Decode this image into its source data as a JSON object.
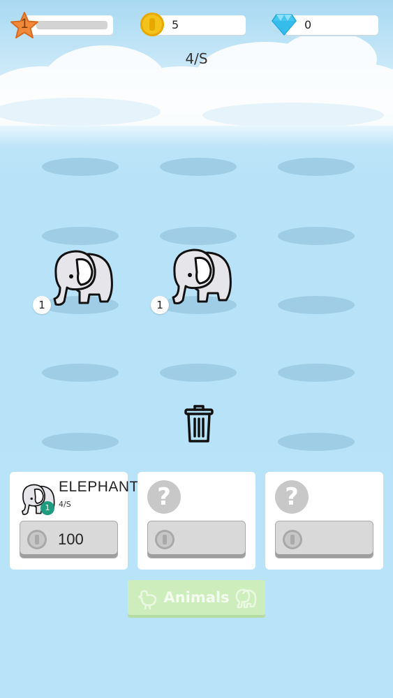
{
  "hud": {
    "level": "1",
    "level_progress": 0.0,
    "coins": "5",
    "gems": "0",
    "income_rate": "4/S"
  },
  "field": {
    "animals": [
      {
        "name": "elephant",
        "level": "1"
      },
      {
        "name": "elephant",
        "level": "1"
      }
    ]
  },
  "shop": {
    "cards": [
      {
        "name": "ELEPHANT",
        "rate": "4/S",
        "badge": "1",
        "price": "100",
        "locked": false
      },
      {
        "name": "",
        "rate": "",
        "badge": "",
        "price": "",
        "locked": true
      },
      {
        "name": "",
        "rate": "",
        "badge": "",
        "price": "",
        "locked": true
      }
    ],
    "mystery_glyph": "?"
  },
  "animals_button": {
    "label": "Animals"
  },
  "colors": {
    "sky": "#b9e3f8",
    "level_star": "#f08a3a",
    "coin": "#f4c21a",
    "gem": "#43c6f0",
    "badge_green": "#1f9c7f",
    "animals_button": "#cdeebc"
  },
  "icons": [
    "star-icon",
    "coin-icon",
    "diamond-icon",
    "trash-icon",
    "elephant-icon",
    "question-icon",
    "chicken-icon"
  ]
}
